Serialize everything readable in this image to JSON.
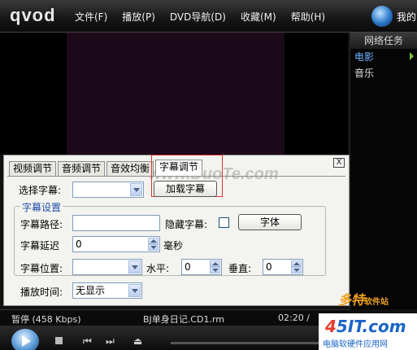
{
  "app": {
    "logo": "qvod",
    "user_label": "我的"
  },
  "menu": [
    "文件(F)",
    "播放(P)",
    "DVD导航(D)",
    "收藏(M)",
    "帮助(H)"
  ],
  "side_panel": {
    "title": "网络任务",
    "items": [
      {
        "label": "电影",
        "active": true
      },
      {
        "label": "音乐",
        "active": false
      }
    ]
  },
  "dialog": {
    "tabs": [
      "视频调节",
      "音频调节",
      "音效均衡",
      "字幕调节"
    ],
    "active_tab": "字幕调节",
    "close_label": "X",
    "watermark": "www.DuoTe.com",
    "select_subtitle_label": "选择字幕:",
    "select_subtitle_value": "",
    "load_subtitle_button": "加载字幕",
    "group_title": "字幕设置",
    "path_label": "字幕路径:",
    "path_value": "",
    "hide_label": "隐藏字幕:",
    "font_button": "字体",
    "delay_label": "字幕延迟",
    "delay_value": "0",
    "delay_unit": "毫秒",
    "position_label": "字幕位置:",
    "position_value": "",
    "horizontal_label": "水平:",
    "horizontal_value": "0",
    "vertical_label": "垂直:",
    "vertical_value": "0",
    "playtime_label": "播放时间:",
    "playtime_value": "无显示"
  },
  "status": {
    "state": "暂停 (458 Kbps)",
    "filename": "BJ单身日记.CD1.rm",
    "time": "02:20 /"
  },
  "watermarks": {
    "site1": "多特",
    "site1_small": "软件站",
    "site2_a": "4",
    "site2_b": "5IT.com",
    "site2_sub": "电脑软硬件应用网"
  },
  "colors": {
    "accent_blue": "#1f4fa8",
    "highlight_red": "#e03030",
    "active_side": "#6fb3ff"
  }
}
